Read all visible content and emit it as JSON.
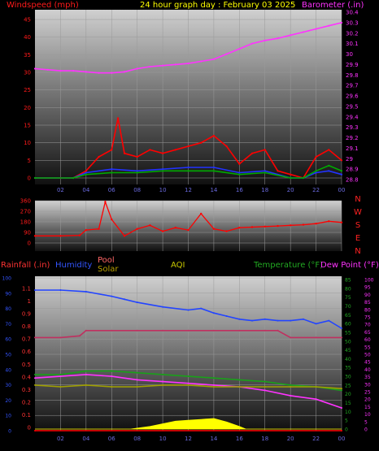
{
  "header": {
    "left_label": "Windspeed (mph)",
    "center_label": "24 hour graph day : February 03 2025",
    "right_label": "Barometer (.in)"
  },
  "colors": {
    "wind_label": "#ff1a1a",
    "title": "#ffff00",
    "baro_label": "#ff33ff",
    "rain_label": "#ff3333",
    "humidity_label": "#3355ff",
    "pool_label": "#ff6666",
    "solar_label": "#b8a000",
    "aqi_label": "#c8c800",
    "temp_label": "#22aa22",
    "dew_label": "#ff33ff"
  },
  "wind_panel": {
    "left_ticks": [
      "45",
      "40",
      "35",
      "30",
      "25",
      "20",
      "15",
      "10",
      "5",
      "0"
    ],
    "right_ticks": [
      "30.4",
      "30.3",
      "30.2",
      "30.1",
      "30",
      "29.9",
      "29.8",
      "29.7",
      "29.6",
      "29.5",
      "29.4",
      "29.3",
      "29.2",
      "29.1",
      "29",
      "28.9",
      "28.8"
    ],
    "x_ticks": [
      "02",
      "04",
      "06",
      "08",
      "10",
      "12",
      "14",
      "16",
      "18",
      "20",
      "22",
      "00"
    ]
  },
  "direction_panel": {
    "left_ticks": [
      "360",
      "270",
      "180",
      "90",
      "0"
    ],
    "compass": [
      "N",
      "W",
      "S",
      "E",
      "N"
    ]
  },
  "bottom_panel": {
    "labels": {
      "rainfall": "Rainfall (.in)",
      "humidity": "Humidity",
      "pool": "Pool",
      "solar": "Solar",
      "aqi": "AQI",
      "temperature": "Temperature (°F)",
      "dew_point": "Dew Point (°F)"
    },
    "left_hum_ticks": [
      "100",
      "90",
      "80",
      "70",
      "60",
      "50",
      "40",
      "30",
      "20",
      "10",
      "0"
    ],
    "left_rain_ticks": [
      "1.1",
      "1",
      "0.9",
      "0.8",
      "0.7",
      "0.6",
      "0.5",
      "0.4",
      "0.3",
      "0.2",
      "0.1",
      "0"
    ],
    "temp_ticks": [
      "85",
      "80",
      "75",
      "70",
      "65",
      "60",
      "55",
      "50",
      "45",
      "40",
      "35",
      "30",
      "25",
      "20",
      "15",
      "10",
      "5",
      "0"
    ],
    "dew_ticks": [
      "100",
      "95",
      "90",
      "85",
      "80",
      "75",
      "70",
      "65",
      "60",
      "55",
      "50",
      "45",
      "40",
      "35",
      "30",
      "25",
      "20",
      "15",
      "10",
      "5",
      "0"
    ],
    "x_ticks": [
      "02",
      "04",
      "06",
      "08",
      "10",
      "12",
      "14",
      "16",
      "18",
      "20",
      "22",
      "00"
    ]
  },
  "chart_data": [
    {
      "type": "line",
      "title": "24 hour graph day : February 03 2025",
      "xlabel": "",
      "ylabel": "Windspeed (mph)",
      "ylabel_right": "Barometer (.in)",
      "x_ticks": [
        "02",
        "04",
        "06",
        "08",
        "10",
        "12",
        "14",
        "16",
        "18",
        "20",
        "22",
        "00"
      ],
      "ylim": [
        0,
        45
      ],
      "ylim_right": [
        28.8,
        30.4
      ],
      "series": [
        {
          "name": "Barometer (.in)",
          "color": "#ff33ff",
          "axis": "right",
          "x": [
            0,
            1,
            2,
            3,
            4,
            5,
            6,
            7,
            8,
            9,
            10,
            11,
            12,
            13,
            14,
            15,
            16,
            17,
            18,
            19,
            20,
            21,
            22,
            23,
            24
          ],
          "values": [
            29.86,
            29.85,
            29.84,
            29.84,
            29.83,
            29.82,
            29.82,
            29.83,
            29.86,
            29.88,
            29.89,
            29.9,
            29.91,
            29.93,
            29.95,
            30.0,
            30.05,
            30.1,
            30.13,
            30.15,
            30.18,
            30.21,
            30.24,
            30.27,
            30.3
          ]
        },
        {
          "name": "Wind speed",
          "color": "#ff0000",
          "axis": "left",
          "x": [
            0,
            2,
            3,
            4,
            5,
            6,
            6.5,
            7,
            8,
            9,
            10,
            11,
            12,
            13,
            14,
            15,
            16,
            17,
            18,
            19,
            20,
            21,
            22,
            23,
            24
          ],
          "values": [
            0,
            0,
            0,
            2,
            6,
            8,
            17,
            7,
            6,
            8,
            7,
            8,
            9,
            10,
            12,
            9,
            4,
            7,
            8,
            2,
            1,
            0,
            6,
            8,
            5
          ]
        },
        {
          "name": "Wind average",
          "color": "#2233ff",
          "axis": "left",
          "x": [
            0,
            3,
            4,
            6,
            8,
            10,
            12,
            14,
            16,
            18,
            20,
            21,
            22,
            23,
            24
          ],
          "values": [
            0,
            0,
            1.5,
            2.5,
            2,
            2.5,
            3,
            3,
            1.5,
            2,
            0,
            0,
            1.5,
            2,
            1
          ]
        },
        {
          "name": "Wind gust",
          "color": "#00aa00",
          "axis": "left",
          "x": [
            0,
            3,
            4,
            6,
            8,
            10,
            12,
            14,
            16,
            18,
            20,
            21,
            22,
            23,
            24
          ],
          "values": [
            0,
            0,
            1,
            1.5,
            1.5,
            2,
            2,
            2,
            1,
            1.5,
            0,
            0,
            2,
            3.5,
            2
          ]
        }
      ]
    },
    {
      "type": "scatter",
      "title": "",
      "xlabel": "",
      "ylabel": "",
      "ylim": [
        0,
        360
      ],
      "series": [
        {
          "name": "Wind direction",
          "color": "#ff0000",
          "x": [
            0,
            2,
            3.5,
            4,
            5,
            5.5,
            6,
            7,
            8,
            9,
            10,
            11,
            12,
            13,
            14,
            15,
            16,
            17,
            18,
            19,
            20,
            21,
            22,
            23,
            24
          ],
          "values": [
            60,
            60,
            65,
            110,
            120,
            350,
            200,
            60,
            120,
            150,
            100,
            130,
            110,
            250,
            120,
            100,
            130,
            135,
            140,
            145,
            150,
            155,
            165,
            185,
            175
          ]
        }
      ]
    },
    {
      "type": "line",
      "title": "",
      "xlabel": "",
      "ylabel": "Humidity",
      "ylabel_right": "Temperature (°F)",
      "ylim": [
        0,
        100
      ],
      "ylim_right": [
        0,
        85
      ],
      "series": [
        {
          "name": "Humidity",
          "color": "#2244ff",
          "axis": "left",
          "x": [
            0,
            2,
            4,
            6,
            7,
            8,
            10,
            12,
            13,
            14,
            15,
            16,
            17,
            18,
            19,
            20,
            21,
            22,
            23,
            24
          ],
          "values": [
            92,
            92,
            91,
            88,
            86,
            84,
            81,
            79,
            80,
            77,
            75,
            73,
            72,
            73,
            72,
            72,
            73,
            70,
            72,
            67
          ]
        },
        {
          "name": "Dew Point (°F)",
          "color": "#ff33ff",
          "axis": "right",
          "x": [
            0,
            2,
            4,
            6,
            8,
            10,
            12,
            14,
            16,
            18,
            20,
            22,
            24
          ],
          "values": [
            29,
            30,
            31,
            30,
            28,
            27,
            26,
            25,
            24,
            22,
            19,
            17,
            12
          ]
        },
        {
          "name": "Temperature (°F)",
          "color": "#1aa01a",
          "axis": "right",
          "x": [
            0,
            2,
            4,
            6,
            8,
            10,
            12,
            14,
            16,
            18,
            20,
            22,
            24
          ],
          "values": [
            31,
            31,
            33,
            33,
            32,
            31,
            30,
            29,
            28,
            27,
            25,
            24,
            22
          ]
        },
        {
          "name": "Pool",
          "color": "#c03060",
          "axis": "right",
          "x": [
            0,
            2,
            3.5,
            4,
            6,
            8,
            10,
            12,
            14,
            16,
            18,
            19,
            20,
            22,
            24
          ],
          "values": [
            52,
            52,
            53,
            56,
            56,
            56,
            56,
            56,
            56,
            56,
            56,
            56,
            52,
            52,
            52
          ]
        },
        {
          "name": "AQI",
          "color": "#a0a000",
          "axis": "right",
          "x": [
            0,
            2,
            4,
            6,
            8,
            10,
            12,
            14,
            16,
            18,
            20,
            22,
            24
          ],
          "values": [
            25,
            24,
            25,
            24,
            24,
            25,
            25,
            24,
            24,
            24,
            24,
            24,
            23
          ]
        },
        {
          "name": "Solar",
          "color": "#ffff00",
          "axis": "right",
          "x": [
            0,
            7.5,
            8,
            9,
            10,
            11,
            12,
            13,
            14,
            15,
            16,
            16.5,
            24
          ],
          "values": [
            0,
            0,
            0.5,
            1.5,
            3,
            4.5,
            5,
            5.5,
            6,
            4,
            1.5,
            0,
            0
          ]
        },
        {
          "name": "Rainfall (.in)",
          "color": "#ff0000",
          "axis": "left",
          "x": [
            0,
            24
          ],
          "values": [
            0,
            0
          ]
        }
      ]
    }
  ]
}
